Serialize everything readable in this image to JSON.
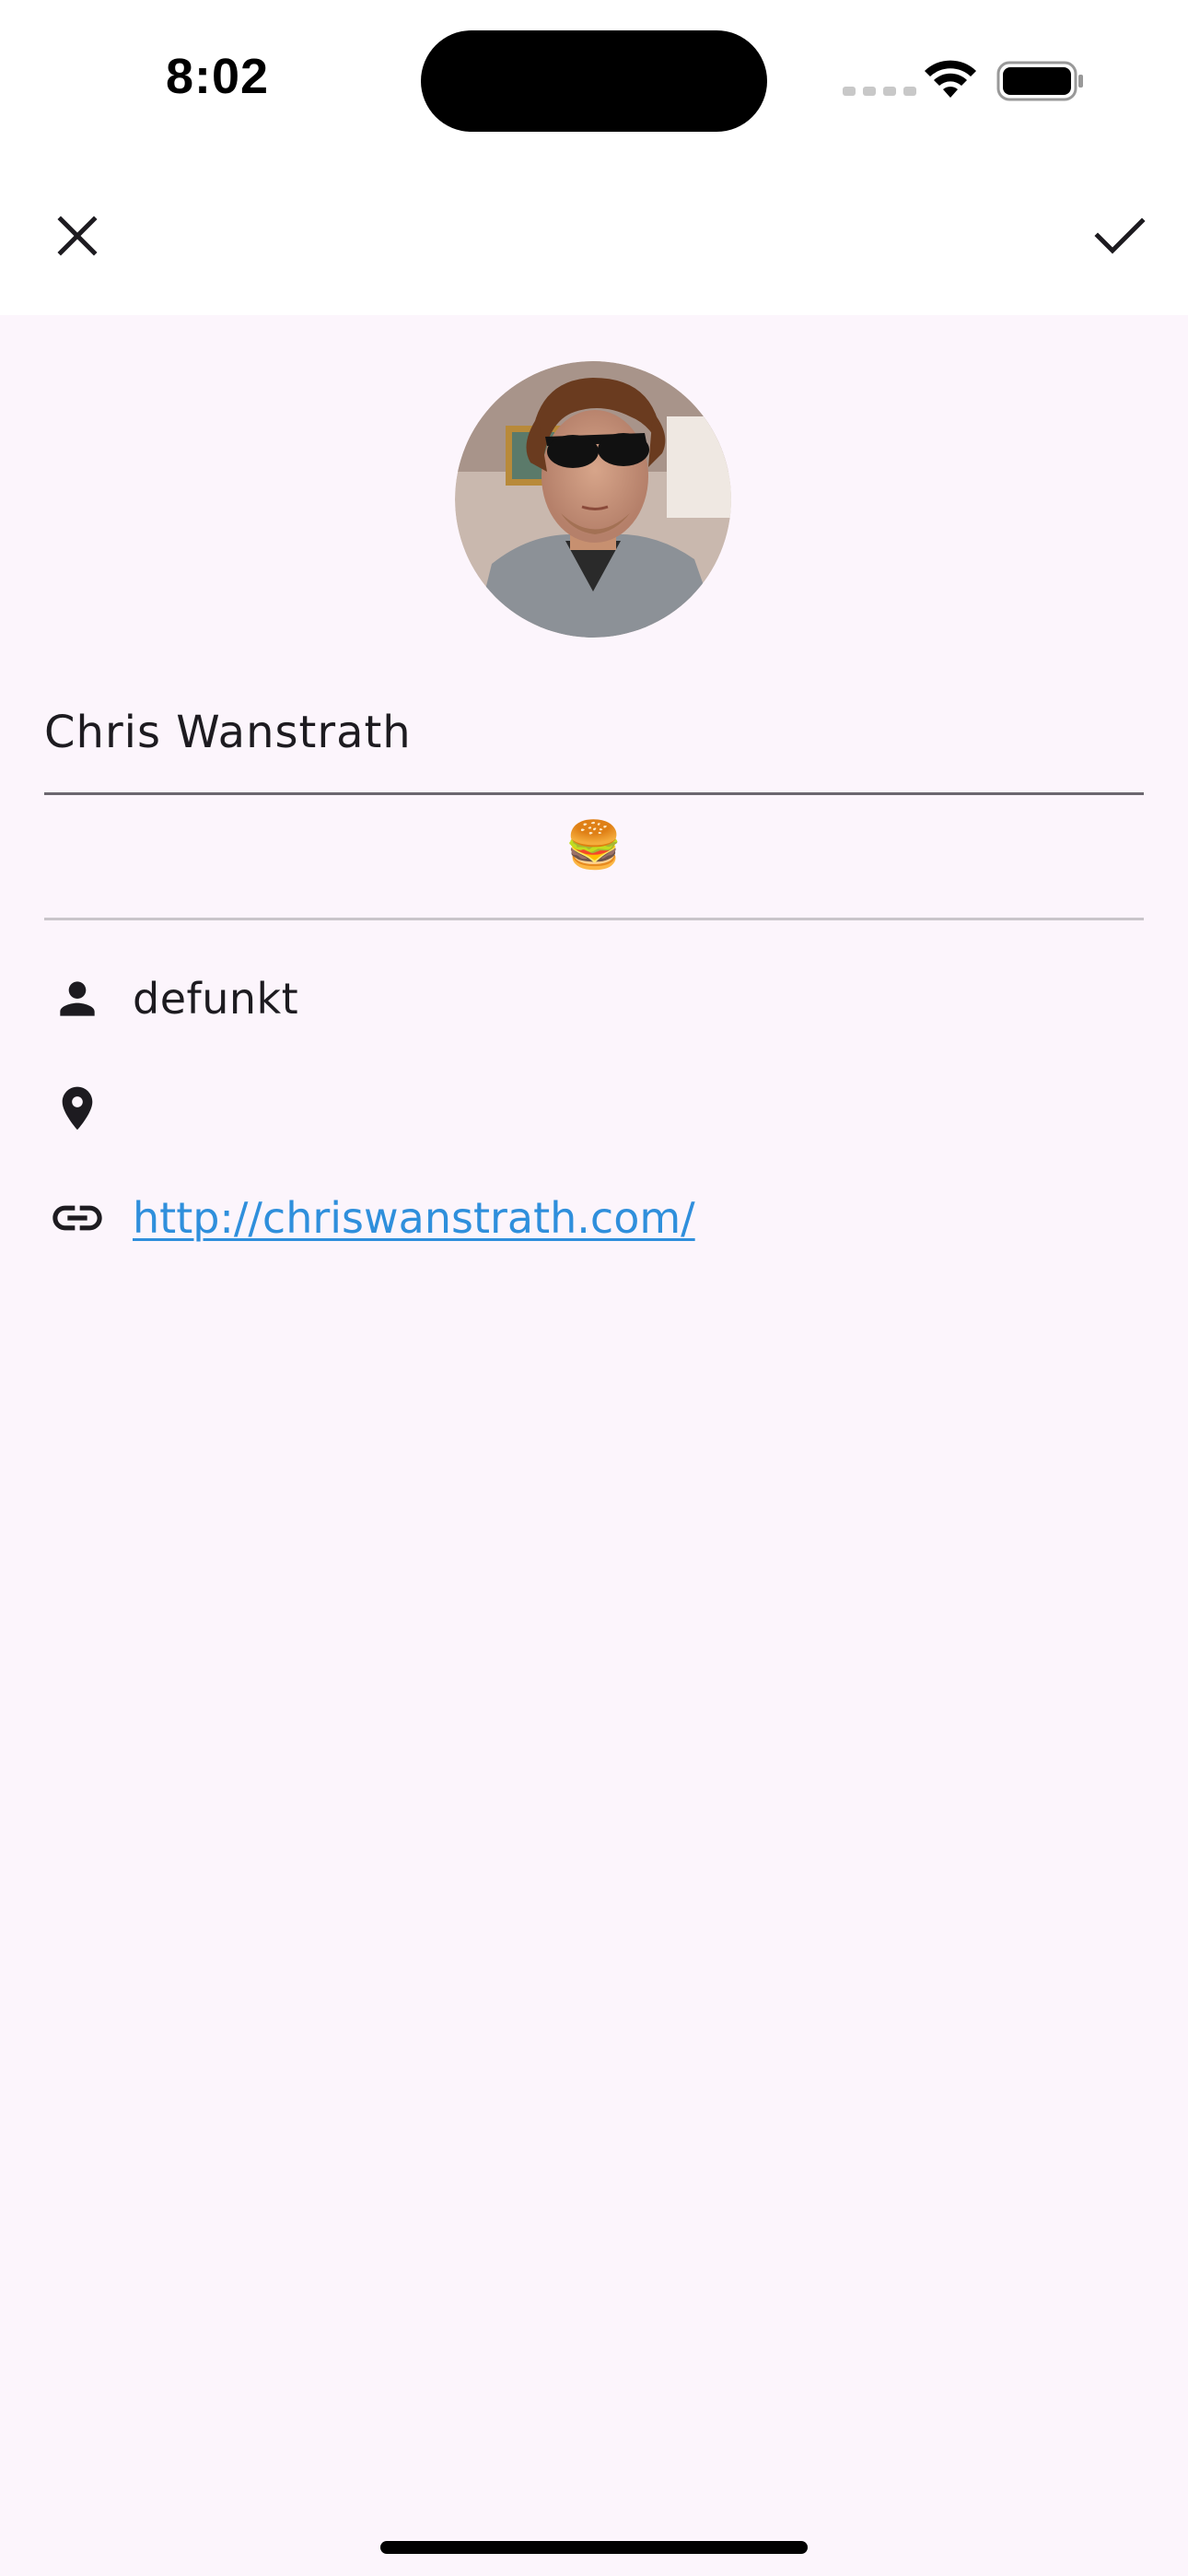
{
  "status_bar": {
    "time": "8:02"
  },
  "app_bar": {
    "close_icon": "close-icon",
    "confirm_icon": "check-icon"
  },
  "profile": {
    "avatar_alt": "avatar",
    "name": "Chris Wanstrath",
    "bio": "🍔",
    "username": "defunkt",
    "location": "",
    "website": "http://chriswanstrath.com/"
  },
  "icons": {
    "username": "person-icon",
    "location": "location-pin-icon",
    "website": "link-icon"
  },
  "colors": {
    "background": "#fcf5fc",
    "link": "#2f8fdc",
    "text": "#1d1b20"
  }
}
